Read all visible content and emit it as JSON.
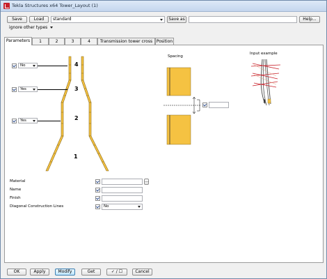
{
  "window": {
    "title": "Tekla Structures x64  Tower_Layout (1)"
  },
  "toolbar": {
    "save_label": "Save",
    "load_label": "Load",
    "preset_value": "standard",
    "save_as_label": "Save as",
    "save_as_value": "",
    "help_label": "Help...",
    "filter_value": "ignore other types"
  },
  "tabs": [
    "Parameters",
    "1",
    "2",
    "3",
    "4",
    "Transmission tower cross arm",
    "Position"
  ],
  "diagram": {
    "segment_labels": [
      "4",
      "3",
      "2",
      "1"
    ],
    "segment_options": [
      {
        "value": "No"
      },
      {
        "value": "Yes"
      },
      {
        "value": "Yes"
      }
    ],
    "spacing_title": "Spacing",
    "spacing_value": "",
    "input_example_title": "Input example",
    "input_example_number": "1"
  },
  "properties": {
    "material_label": "Material",
    "material_value": "",
    "material_browse": "...",
    "name_label": "Name",
    "name_value": "",
    "finish_label": "Finish",
    "finish_value": "",
    "diag_label": "Diagonal Construction Lines",
    "diag_value": "No"
  },
  "footer": {
    "ok_label": "OK",
    "apply_label": "Apply",
    "modify_label": "Modify",
    "get_label": "Get",
    "toggle_label": "✓ / ☐",
    "cancel_label": "Cancel"
  },
  "colors": {
    "member": "#f5c242",
    "member_stroke": "#8a6a1a",
    "accent": "#c8202a"
  }
}
